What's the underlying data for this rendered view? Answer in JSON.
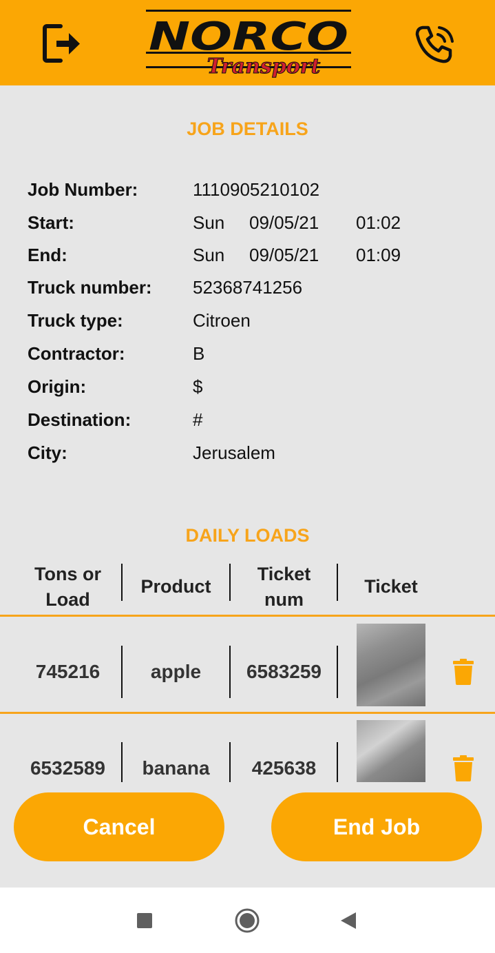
{
  "header": {
    "logo_main": "NORCO",
    "logo_sub": "Transport",
    "logout_icon": "logout-icon",
    "phone_icon": "phone-icon"
  },
  "job_details": {
    "title": "JOB DETAILS",
    "job_number": {
      "label": "Job Number:",
      "value": "1110905210102"
    },
    "start": {
      "label": "Start:",
      "day": "Sun",
      "date": "09/05/21",
      "time": "01:02"
    },
    "end": {
      "label": "End:",
      "day": "Sun",
      "date": "09/05/21",
      "time": "01:09"
    },
    "truck_number": {
      "label": "Truck number:",
      "value": "52368741256"
    },
    "truck_type": {
      "label": "Truck type:",
      "value": "Citroen"
    },
    "contractor": {
      "label": "Contractor:",
      "value": "B"
    },
    "origin": {
      "label": "Origin:",
      "value": "$"
    },
    "destination": {
      "label": "Destination:",
      "value": "#"
    },
    "city": {
      "label": "City:",
      "value": "Jerusalem"
    }
  },
  "daily_loads": {
    "title": "DAILY LOADS",
    "columns": [
      "Tons or\nLoad",
      "Product",
      "Ticket\nnum",
      "Ticket"
    ],
    "rows": [
      {
        "tons": "745216",
        "product": "apple",
        "ticket_num": "6583259"
      },
      {
        "tons": "6532589",
        "product": "banana",
        "ticket_num": "425638"
      }
    ]
  },
  "buttons": {
    "cancel": "Cancel",
    "end_job": "End Job"
  },
  "colors": {
    "accent": "#fba704",
    "title": "#f7a41b",
    "background": "#e6e6e6"
  }
}
